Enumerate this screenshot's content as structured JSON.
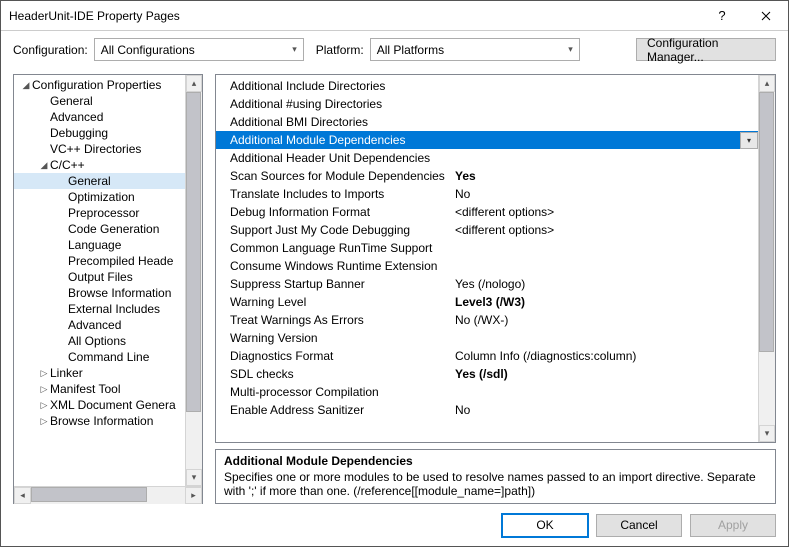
{
  "titlebar": {
    "title": "HeaderUnit-IDE Property Pages"
  },
  "toolbar": {
    "config_label": "Configuration:",
    "config_value": "All Configurations",
    "platform_label": "Platform:",
    "platform_value": "All Platforms",
    "config_mgr_label": "Configuration Manager..."
  },
  "tree": {
    "items": [
      {
        "indent": 0,
        "expander": "◢",
        "label": "Configuration Properties"
      },
      {
        "indent": 1,
        "expander": "",
        "label": "General"
      },
      {
        "indent": 1,
        "expander": "",
        "label": "Advanced"
      },
      {
        "indent": 1,
        "expander": "",
        "label": "Debugging"
      },
      {
        "indent": 1,
        "expander": "",
        "label": "VC++ Directories"
      },
      {
        "indent": 1,
        "expander": "◢",
        "label": "C/C++"
      },
      {
        "indent": 2,
        "expander": "",
        "label": "General",
        "selected": true
      },
      {
        "indent": 2,
        "expander": "",
        "label": "Optimization"
      },
      {
        "indent": 2,
        "expander": "",
        "label": "Preprocessor"
      },
      {
        "indent": 2,
        "expander": "",
        "label": "Code Generation"
      },
      {
        "indent": 2,
        "expander": "",
        "label": "Language"
      },
      {
        "indent": 2,
        "expander": "",
        "label": "Precompiled Heade"
      },
      {
        "indent": 2,
        "expander": "",
        "label": "Output Files"
      },
      {
        "indent": 2,
        "expander": "",
        "label": "Browse Information"
      },
      {
        "indent": 2,
        "expander": "",
        "label": "External Includes"
      },
      {
        "indent": 2,
        "expander": "",
        "label": "Advanced"
      },
      {
        "indent": 2,
        "expander": "",
        "label": "All Options"
      },
      {
        "indent": 2,
        "expander": "",
        "label": "Command Line"
      },
      {
        "indent": 1,
        "expander": "▷",
        "label": "Linker"
      },
      {
        "indent": 1,
        "expander": "▷",
        "label": "Manifest Tool"
      },
      {
        "indent": 1,
        "expander": "▷",
        "label": "XML Document Genera"
      },
      {
        "indent": 1,
        "expander": "▷",
        "label": "Browse Information"
      }
    ]
  },
  "grid": {
    "rows": [
      {
        "prop": "Additional Include Directories",
        "val": ""
      },
      {
        "prop": "Additional #using Directories",
        "val": ""
      },
      {
        "prop": "Additional BMI Directories",
        "val": ""
      },
      {
        "prop": "Additional Module Dependencies",
        "val": "",
        "selected": true,
        "dropdown": true
      },
      {
        "prop": "Additional Header Unit Dependencies",
        "val": ""
      },
      {
        "prop": "Scan Sources for Module Dependencies",
        "val": "Yes",
        "bold": true
      },
      {
        "prop": "Translate Includes to Imports",
        "val": "No"
      },
      {
        "prop": "Debug Information Format",
        "val": "<different options>"
      },
      {
        "prop": "Support Just My Code Debugging",
        "val": "<different options>"
      },
      {
        "prop": "Common Language RunTime Support",
        "val": ""
      },
      {
        "prop": "Consume Windows Runtime Extension",
        "val": ""
      },
      {
        "prop": "Suppress Startup Banner",
        "val": "Yes (/nologo)"
      },
      {
        "prop": "Warning Level",
        "val": "Level3 (/W3)",
        "bold": true
      },
      {
        "prop": "Treat Warnings As Errors",
        "val": "No (/WX-)"
      },
      {
        "prop": "Warning Version",
        "val": ""
      },
      {
        "prop": "Diagnostics Format",
        "val": "Column Info (/diagnostics:column)"
      },
      {
        "prop": "SDL checks",
        "val": "Yes (/sdl)",
        "bold": true
      },
      {
        "prop": "Multi-processor Compilation",
        "val": ""
      },
      {
        "prop": "Enable Address Sanitizer",
        "val": "No"
      }
    ]
  },
  "description": {
    "heading": "Additional Module Dependencies",
    "text": "Specifies one or more modules to be used to resolve names passed to an import directive. Separate with ';' if more than one.  (/reference[[module_name=]path])"
  },
  "footer": {
    "ok": "OK",
    "cancel": "Cancel",
    "apply": "Apply"
  }
}
